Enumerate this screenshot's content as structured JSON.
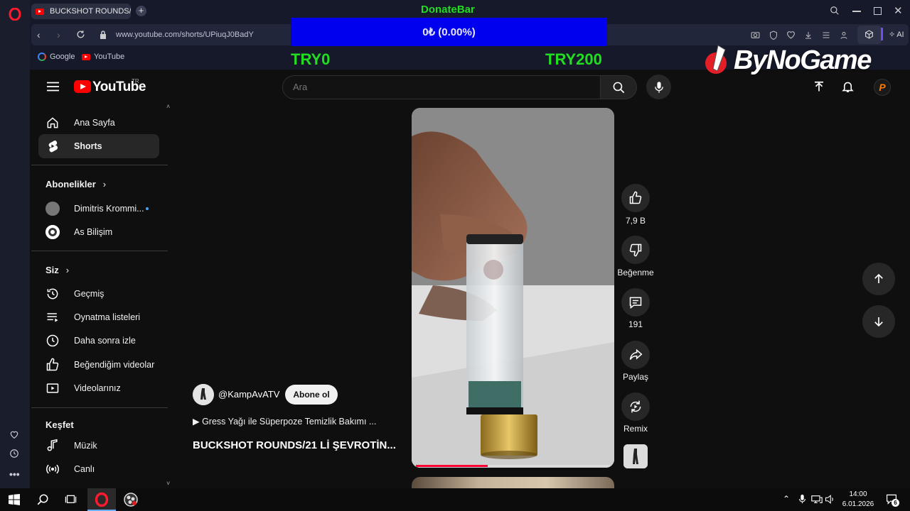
{
  "browser": {
    "tab_title": "BUCKSHOT ROUNDS/",
    "url": "www.youtube.com/shorts/UPiuqJ0BadY",
    "ai_label": "AI",
    "bookmarks": [
      "Google",
      "YouTube"
    ]
  },
  "overlay": {
    "donate_title": "DonateBar",
    "donate_progress": "0₺ (0.00%)",
    "donate_min": "TRY0",
    "donate_max": "TRY200",
    "brand": "ByNoGame"
  },
  "youtube": {
    "logo": "YouTube",
    "region": "TR",
    "search_placeholder": "Ara",
    "avatar_letter": "P"
  },
  "sidebar": {
    "main": [
      {
        "label": "Ana Sayfa",
        "icon": "home-icon"
      },
      {
        "label": "Shorts",
        "icon": "shorts-icon"
      }
    ],
    "subscriptions_title": "Abonelikler",
    "subscriptions": [
      {
        "label": "Dimitris Krommi..."
      },
      {
        "label": "As Bilişim"
      }
    ],
    "you_title": "Siz",
    "you": [
      {
        "label": "Geçmiş",
        "icon": "history-icon"
      },
      {
        "label": "Oynatma listeleri",
        "icon": "playlist-icon"
      },
      {
        "label": "Daha sonra izle",
        "icon": "watch-later-icon"
      },
      {
        "label": "Beğendiğim videolar",
        "icon": "thumbs-up-icon"
      },
      {
        "label": "Videolarınız",
        "icon": "your-videos-icon"
      }
    ],
    "explore_title": "Keşfet",
    "explore": [
      {
        "label": "Müzik",
        "icon": "music-icon"
      },
      {
        "label": "Canlı",
        "icon": "live-icon"
      }
    ]
  },
  "short": {
    "channel": "@KampAvATV",
    "subscribe_label": "Abone ol",
    "playlist_line": "▶ Gress Yağı ile Süperpoze Temizlik Bakımı ...",
    "title": "BUCKSHOT ROUNDS/21 Lİ ŞEVROTİN...",
    "progress": 0.37,
    "likes": "7,9 B",
    "dislike_label": "Beğenme",
    "comments": "191",
    "share_label": "Paylaş",
    "remix_label": "Remix"
  },
  "taskbar": {
    "time": "14:00",
    "date": "6.01.2026",
    "notification_count": "6"
  },
  "colors": {
    "yt_red": "#ff0000",
    "donate_blue": "#0000ee",
    "donate_green": "#22dd22",
    "opera_red": "#ff1b2d"
  }
}
